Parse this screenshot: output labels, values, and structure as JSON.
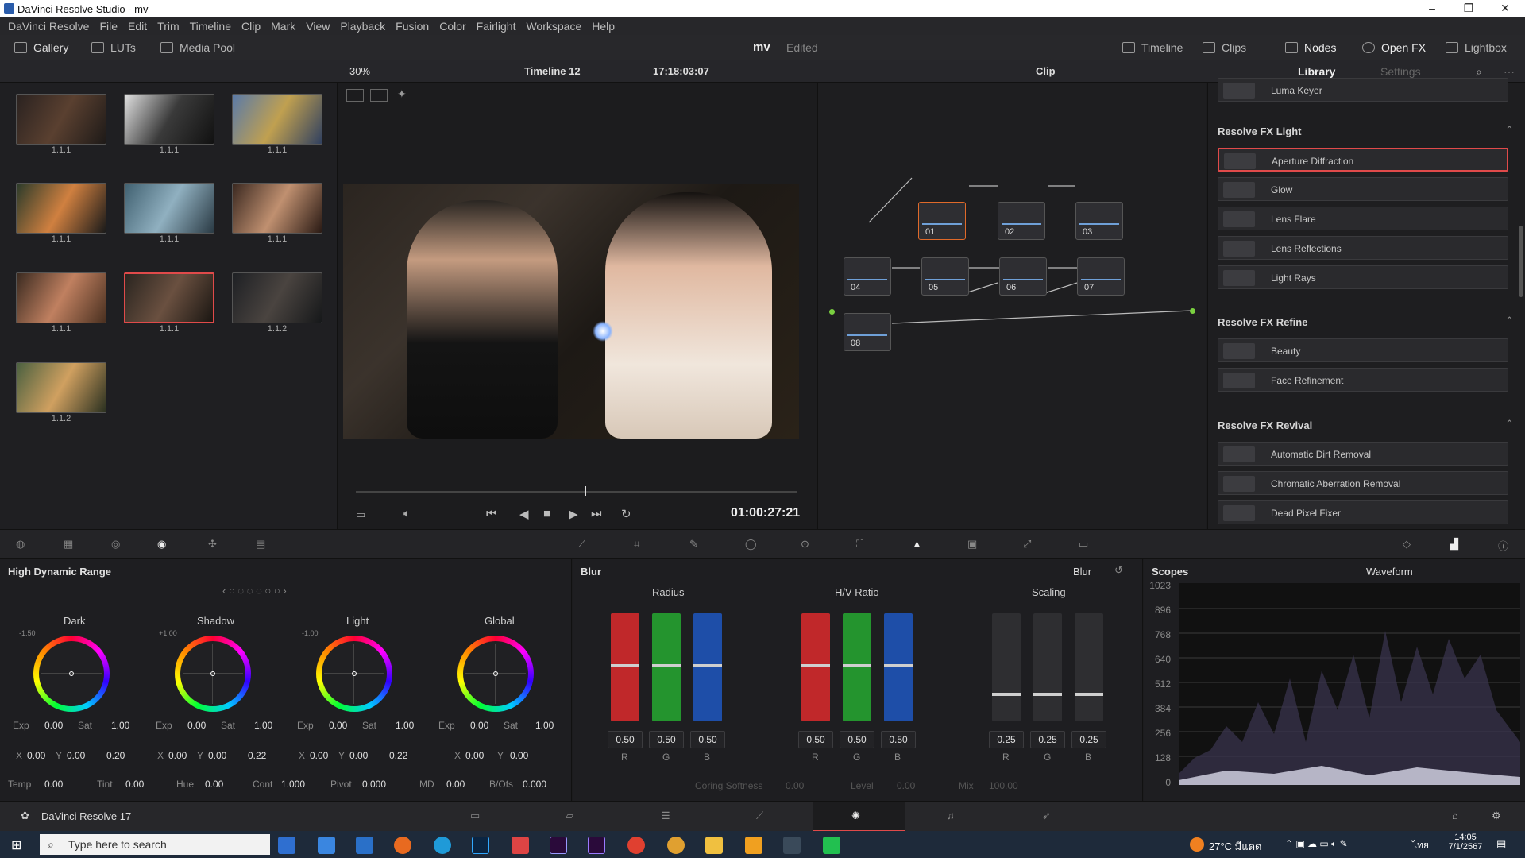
{
  "window": {
    "title": "DaVinci Resolve Studio - mv"
  },
  "menu": [
    "DaVinci Resolve",
    "File",
    "Edit",
    "Trim",
    "Timeline",
    "Clip",
    "Mark",
    "View",
    "Playback",
    "Fusion",
    "Color",
    "Fairlight",
    "Workspace",
    "Help"
  ],
  "toolbar": {
    "gallery": "Gallery",
    "luts": "LUTs",
    "media_pool": "Media Pool",
    "project": "mv",
    "status": "Edited",
    "timeline": "Timeline",
    "clips": "Clips",
    "nodes": "Nodes",
    "open_fx": "Open FX",
    "lightbox": "Lightbox"
  },
  "viewer": {
    "zoom": "30%",
    "timeline_name": "Timeline 12",
    "timecode_top": "17:18:03:07",
    "timecode": "01:00:27:21",
    "clip_mode": "Clip"
  },
  "gallery": {
    "thumbs": [
      "1.1.1",
      "1.1.1",
      "1.1.1",
      "1.1.1",
      "1.1.1",
      "1.1.1",
      "1.1.1",
      "1.1.1",
      "1.1.2",
      "1.1.2"
    ]
  },
  "nodes": [
    "01",
    "02",
    "03",
    "04",
    "05",
    "06",
    "07",
    "08"
  ],
  "library": {
    "tab_library": "Library",
    "tab_settings": "Settings",
    "luma": "Luma Keyer",
    "sections": [
      {
        "title": "Resolve FX Light",
        "items": [
          "Aperture Diffraction",
          "Glow",
          "Lens Flare",
          "Lens Reflections",
          "Light Rays"
        ]
      },
      {
        "title": "Resolve FX Refine",
        "items": [
          "Beauty",
          "Face Refinement"
        ]
      },
      {
        "title": "Resolve FX Revival",
        "items": [
          "Automatic Dirt Removal",
          "Chromatic Aberration Removal",
          "Dead Pixel Fixer"
        ]
      }
    ]
  },
  "hdr": {
    "title": "High Dynamic Range",
    "wheels": [
      {
        "name": "Dark",
        "level": "-1.50",
        "exp": "0.00",
        "sat": "1.00",
        "x": "0.00",
        "y": "0.00",
        "extra": "0.20"
      },
      {
        "name": "Shadow",
        "level": "+1.00",
        "exp": "0.00",
        "sat": "1.00",
        "x": "0.00",
        "y": "0.00",
        "extra": "0.22"
      },
      {
        "name": "Light",
        "level": "-1.00",
        "exp": "0.00",
        "sat": "1.00",
        "x": "0.00",
        "y": "0.00",
        "extra": "0.22"
      },
      {
        "name": "Global",
        "level": "",
        "exp": "0.00",
        "sat": "1.00",
        "x": "0.00",
        "y": "0.00",
        "extra": ""
      }
    ],
    "labels": {
      "exp": "Exp",
      "sat": "Sat",
      "x": "X",
      "y": "Y",
      "temp": "Temp",
      "tint": "Tint",
      "hue": "Hue",
      "cont": "Cont",
      "pivot": "Pivot",
      "md": "MD",
      "bofs": "B/Ofs"
    },
    "bottom": {
      "temp": "0.00",
      "tint": "0.00",
      "hue": "0.00",
      "cont": "1.000",
      "pivot": "0.000",
      "md": "0.00",
      "bofs": "0.000"
    }
  },
  "blur": {
    "title": "Blur",
    "mode": "Blur",
    "radius": "Radius",
    "hv": "H/V Ratio",
    "scaling": "Scaling",
    "radius_vals": [
      "0.50",
      "0.50",
      "0.50"
    ],
    "hv_vals": [
      "0.50",
      "0.50",
      "0.50"
    ],
    "scaling_vals": [
      "0.25",
      "0.25",
      "0.25"
    ],
    "rgb": [
      "R",
      "G",
      "B"
    ],
    "coring": "Coring Softness",
    "coring_val": "0.00",
    "level": "Level",
    "level_val": "0.00",
    "mix": "Mix",
    "mix_val": "100.00"
  },
  "scopes": {
    "title": "Scopes",
    "mode": "Waveform",
    "ticks": [
      "1023",
      "896",
      "768",
      "640",
      "512",
      "384",
      "256",
      "128",
      "0"
    ]
  },
  "pagebar": {
    "app": "DaVinci Resolve 17"
  },
  "taskbar": {
    "search": "Type here to search",
    "weather": "27°C มีแดด",
    "time": "14:05",
    "date": "7/1/2567",
    "lang": "ไทย"
  }
}
